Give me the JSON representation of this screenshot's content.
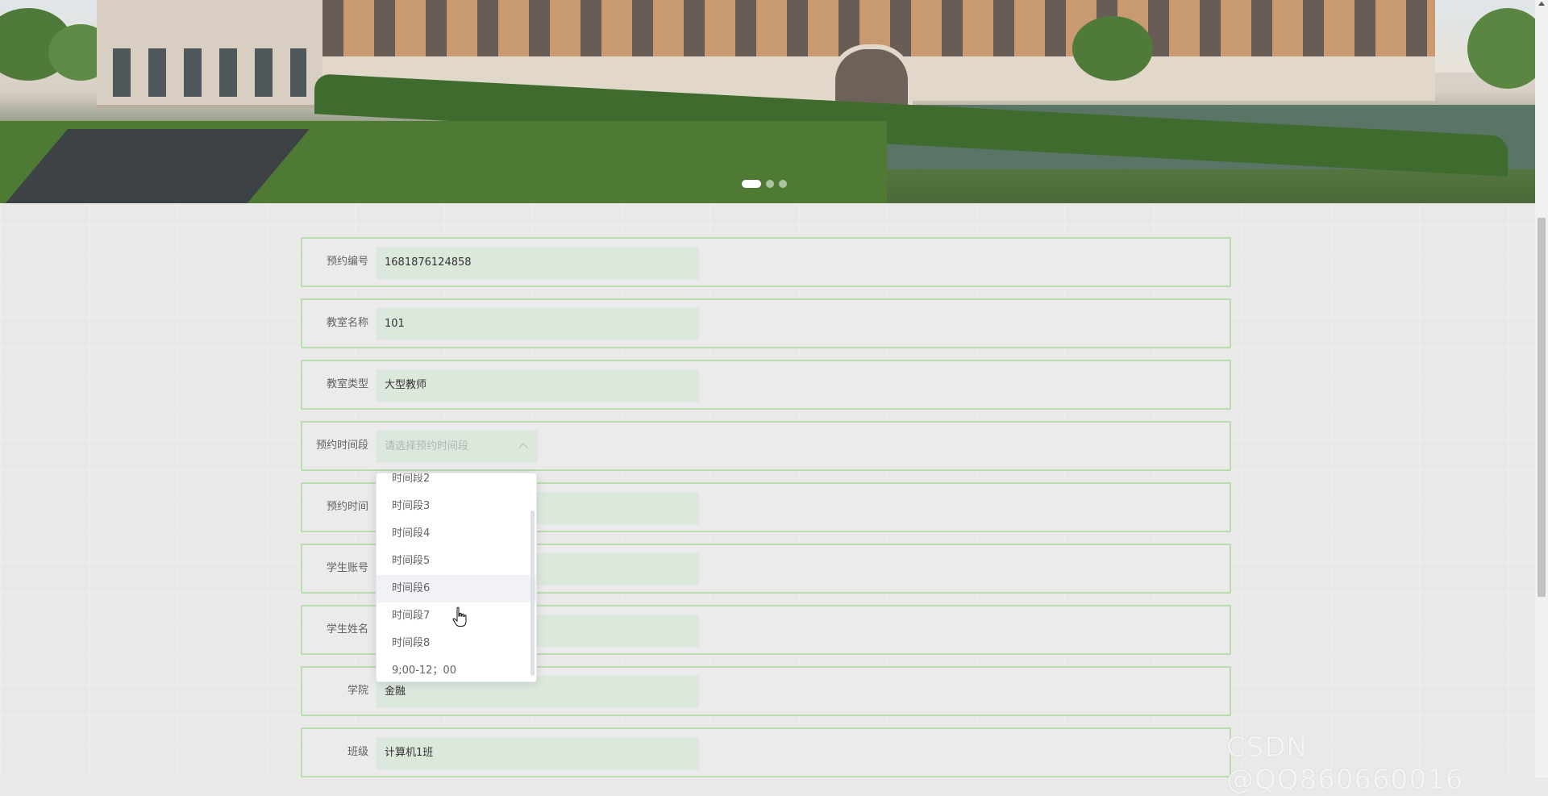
{
  "banner": {
    "carousel_dots": [
      true,
      false,
      false
    ]
  },
  "form": {
    "rows": [
      {
        "label": "预约编号",
        "value": "1681876124858"
      },
      {
        "label": "教室名称",
        "value": "101"
      },
      {
        "label": "教室类型",
        "value": "大型教师"
      },
      {
        "label": "预约时间段",
        "placeholder": "请选择预约时间段"
      },
      {
        "label": "预约时间",
        "value": ""
      },
      {
        "label": "学生账号",
        "value": ""
      },
      {
        "label": "学生姓名",
        "value": ""
      },
      {
        "label": "学院",
        "value": "金融"
      },
      {
        "label": "班级",
        "value": "计算机1班"
      }
    ]
  },
  "dropdown": {
    "options": [
      "时间段2",
      "时间段3",
      "时间段4",
      "时间段5",
      "时间段6",
      "时间段7",
      "时间段8",
      "9;00-12；00"
    ],
    "hovered": "时间段6"
  },
  "watermark": "CSDN @QQ860660016"
}
